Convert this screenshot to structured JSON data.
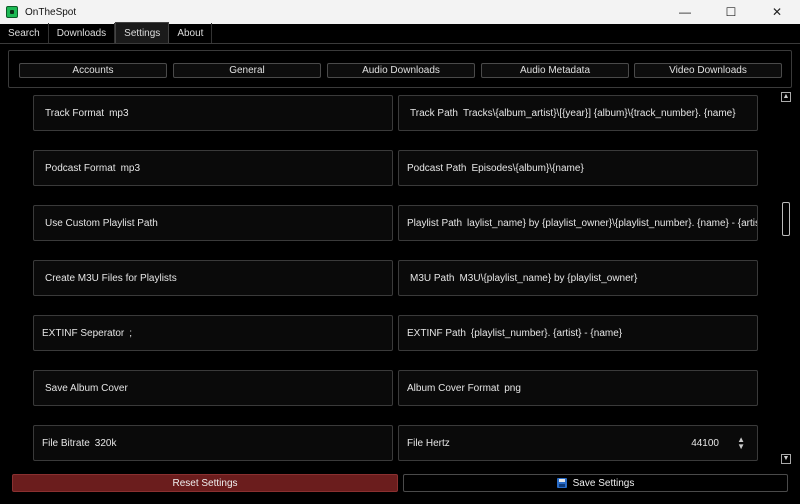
{
  "window": {
    "title": "OnTheSpot",
    "controls": {
      "minimize": "—",
      "maximize": "☐",
      "close": "✕"
    }
  },
  "tabs": [
    "Search",
    "Downloads",
    "Settings",
    "About"
  ],
  "active_tab": "Settings",
  "subtabs": [
    "Accounts",
    "General",
    "Audio Downloads",
    "Audio Metadata",
    "Video Downloads"
  ],
  "settings": {
    "track_format": {
      "label": "Track Format",
      "value": "mp3"
    },
    "track_path": {
      "label": "Track Path",
      "value": "Tracks\\{album_artist}\\[{year}] {album}\\{track_number}. {name}"
    },
    "podcast_format": {
      "label": "Podcast Format",
      "value": "mp3"
    },
    "podcast_path": {
      "label": "Podcast Path",
      "value": "Episodes\\{album}\\{name}"
    },
    "use_custom_playlist_path": {
      "label": "Use Custom Playlist Path"
    },
    "playlist_path": {
      "label": "Playlist Path",
      "value": "laylist_name} by {playlist_owner}\\{playlist_number}. {name} - {artist}"
    },
    "create_m3u": {
      "label": "Create M3U Files for Playlists"
    },
    "m3u_path": {
      "label": "M3U Path",
      "value": "M3U\\{playlist_name} by {playlist_owner}"
    },
    "extinf_separator": {
      "label": "EXTINF Seperator",
      "value": ";"
    },
    "extinf_path": {
      "label": "EXTINF Path",
      "value": "{playlist_number}. {artist} - {name}"
    },
    "save_album_cover": {
      "label": "Save Album Cover"
    },
    "album_cover_format": {
      "label": "Album Cover Format",
      "value": "png"
    },
    "file_bitrate": {
      "label": "File Bitrate",
      "value": "320k"
    },
    "file_hertz": {
      "label": "File Hertz",
      "value": "44100"
    }
  },
  "icons": {
    "scroll_up": "▲",
    "scroll_down": "▼",
    "spin_up": "▲",
    "spin_down": "▼"
  },
  "buttons": {
    "reset": "Reset Settings",
    "save": "Save Settings"
  },
  "colors": {
    "reset_button": "#6b1d1d",
    "app_accent": "#1db954"
  }
}
